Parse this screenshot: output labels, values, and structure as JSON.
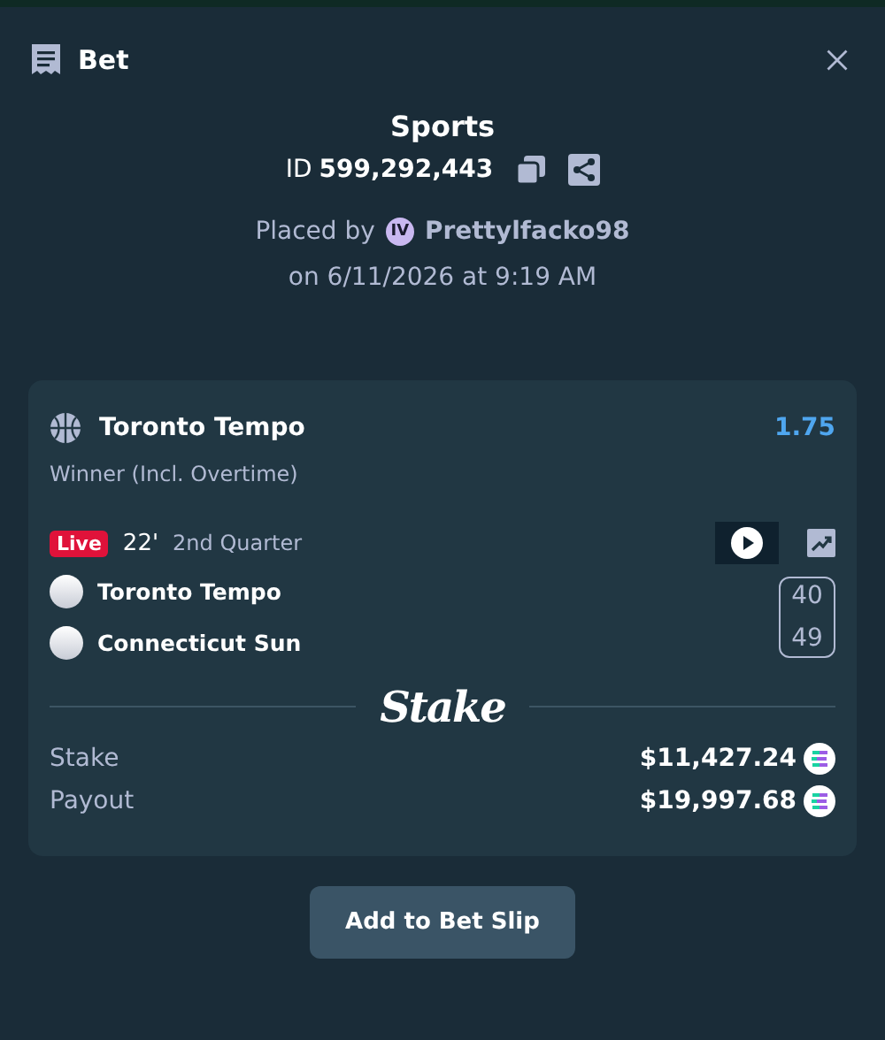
{
  "header": {
    "title": "Bet"
  },
  "summary": {
    "category": "Sports",
    "id_label": "ID",
    "id_value": "599,292,443",
    "placed_by_label": "Placed by",
    "user_badge": "IV",
    "username": "Prettylfacko98",
    "placed_on": "on 6/11/2026 at 9:19 AM"
  },
  "bet": {
    "selection": "Toronto Tempo",
    "odds": "1.75",
    "market": "Winner (Incl. Overtime)",
    "live_label": "Live",
    "clock": "22'",
    "period": "2nd Quarter",
    "teams": [
      {
        "name": "Toronto Tempo",
        "score": "40"
      },
      {
        "name": "Connecticut Sun",
        "score": "49"
      }
    ],
    "brand": "Stake",
    "amounts": [
      {
        "label": "Stake",
        "value": "$11,427.24"
      },
      {
        "label": "Payout",
        "value": "$19,997.68"
      }
    ]
  },
  "button": "Add to Bet Slip"
}
